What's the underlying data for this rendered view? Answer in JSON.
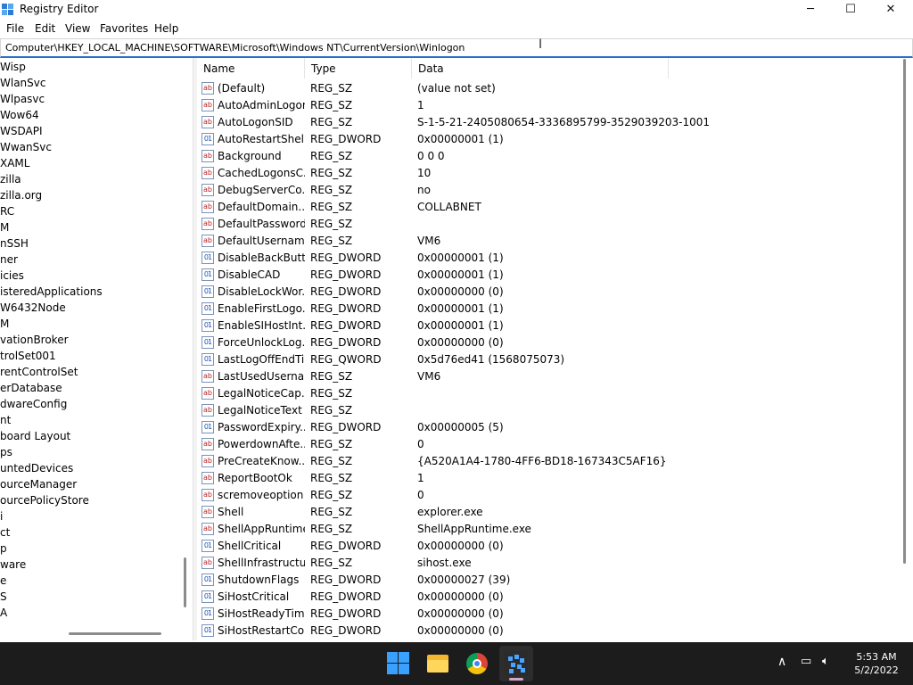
{
  "window": {
    "title": "Registry Editor",
    "icon": "registry-editor-icon",
    "controls": {
      "minimize": "─",
      "maximize": "☐",
      "close": "✕"
    }
  },
  "menu": [
    "File",
    "Edit",
    "View",
    "Favorites",
    "Help"
  ],
  "address": {
    "path": "Computer\\HKEY_LOCAL_MACHINE\\SOFTWARE\\Microsoft\\Windows NT\\CurrentVersion\\Winlogon"
  },
  "tree": {
    "items": [
      "Wisp",
      "WlanSvc",
      "Wlpasvc",
      "Wow64",
      "WSDAPI",
      "WwanSvc",
      "XAML",
      "zilla",
      "zilla.org",
      "RC",
      "M",
      "nSSH",
      "ner",
      "icies",
      "isteredApplications",
      "W6432Node",
      "M",
      "vationBroker",
      "trolSet001",
      "rentControlSet",
      "erDatabase",
      "dwareConfig",
      "nt",
      "board Layout",
      "ps",
      "untedDevices",
      "ourceManager",
      "ourcePolicyStore",
      "i",
      "ct",
      "p",
      "ware",
      "e",
      "S",
      "A"
    ]
  },
  "values": {
    "columns": [
      "Name",
      "Type",
      "Data"
    ],
    "rows": [
      {
        "icon": "string",
        "name": "(Default)",
        "type": "REG_SZ",
        "data": "(value not set)"
      },
      {
        "icon": "string",
        "name": "AutoAdminLogon",
        "type": "REG_SZ",
        "data": "1"
      },
      {
        "icon": "string",
        "name": "AutoLogonSID",
        "type": "REG_SZ",
        "data": "S-1-5-21-2405080654-3336895799-3529039203-1001"
      },
      {
        "icon": "binary",
        "name": "AutoRestartShell",
        "type": "REG_DWORD",
        "data": "0x00000001 (1)"
      },
      {
        "icon": "string",
        "name": "Background",
        "type": "REG_SZ",
        "data": "0 0 0"
      },
      {
        "icon": "string",
        "name": "CachedLogonsC...",
        "type": "REG_SZ",
        "data": "10"
      },
      {
        "icon": "string",
        "name": "DebugServerCo...",
        "type": "REG_SZ",
        "data": "no"
      },
      {
        "icon": "string",
        "name": "DefaultDomain...",
        "type": "REG_SZ",
        "data": "COLLABNET"
      },
      {
        "icon": "string",
        "name": "DefaultPassword",
        "type": "REG_SZ",
        "data": ""
      },
      {
        "icon": "string",
        "name": "DefaultUsername",
        "type": "REG_SZ",
        "data": "VM6"
      },
      {
        "icon": "binary",
        "name": "DisableBackButt...",
        "type": "REG_DWORD",
        "data": "0x00000001 (1)"
      },
      {
        "icon": "binary",
        "name": "DisableCAD",
        "type": "REG_DWORD",
        "data": "0x00000001 (1)"
      },
      {
        "icon": "binary",
        "name": "DisableLockWor...",
        "type": "REG_DWORD",
        "data": "0x00000000 (0)"
      },
      {
        "icon": "binary",
        "name": "EnableFirstLogo...",
        "type": "REG_DWORD",
        "data": "0x00000001 (1)"
      },
      {
        "icon": "binary",
        "name": "EnableSIHostInt...",
        "type": "REG_DWORD",
        "data": "0x00000001 (1)"
      },
      {
        "icon": "binary",
        "name": "ForceUnlockLog...",
        "type": "REG_DWORD",
        "data": "0x00000000 (0)"
      },
      {
        "icon": "binary",
        "name": "LastLogOffEndTi...",
        "type": "REG_QWORD",
        "data": "0x5d76ed41 (1568075073)"
      },
      {
        "icon": "string",
        "name": "LastUsedUserna...",
        "type": "REG_SZ",
        "data": "VM6"
      },
      {
        "icon": "string",
        "name": "LegalNoticeCap...",
        "type": "REG_SZ",
        "data": ""
      },
      {
        "icon": "string",
        "name": "LegalNoticeText",
        "type": "REG_SZ",
        "data": ""
      },
      {
        "icon": "binary",
        "name": "PasswordExpiry...",
        "type": "REG_DWORD",
        "data": "0x00000005 (5)"
      },
      {
        "icon": "string",
        "name": "PowerdownAfte...",
        "type": "REG_SZ",
        "data": "0"
      },
      {
        "icon": "string",
        "name": "PreCreateKnow...",
        "type": "REG_SZ",
        "data": "{A520A1A4-1780-4FF6-BD18-167343C5AF16}"
      },
      {
        "icon": "string",
        "name": "ReportBootOk",
        "type": "REG_SZ",
        "data": "1"
      },
      {
        "icon": "string",
        "name": "scremoveoption",
        "type": "REG_SZ",
        "data": "0"
      },
      {
        "icon": "string",
        "name": "Shell",
        "type": "REG_SZ",
        "data": "explorer.exe"
      },
      {
        "icon": "string",
        "name": "ShellAppRuntime",
        "type": "REG_SZ",
        "data": "ShellAppRuntime.exe"
      },
      {
        "icon": "binary",
        "name": "ShellCritical",
        "type": "REG_DWORD",
        "data": "0x00000000 (0)"
      },
      {
        "icon": "string",
        "name": "ShellInfrastructure",
        "type": "REG_SZ",
        "data": "sihost.exe"
      },
      {
        "icon": "binary",
        "name": "ShutdownFlags",
        "type": "REG_DWORD",
        "data": "0x00000027 (39)"
      },
      {
        "icon": "binary",
        "name": "SiHostCritical",
        "type": "REG_DWORD",
        "data": "0x00000000 (0)"
      },
      {
        "icon": "binary",
        "name": "SiHostReadyTim...",
        "type": "REG_DWORD",
        "data": "0x00000000 (0)"
      },
      {
        "icon": "binary",
        "name": "SiHostRestartCo...",
        "type": "REG_DWORD",
        "data": "0x00000000 (0)"
      }
    ]
  },
  "taskbar": {
    "apps": [
      "start-icon",
      "file-explorer-icon",
      "chrome-icon",
      "registry-editor-icon"
    ],
    "tray_icons": [
      "chevron-up-icon",
      "network-icon",
      "volume-icon"
    ],
    "time": "5:53 AM",
    "date": "5/2/2022"
  },
  "colors": {
    "accent": "#2b6fc9",
    "taskbar": "#1c1c1c"
  }
}
